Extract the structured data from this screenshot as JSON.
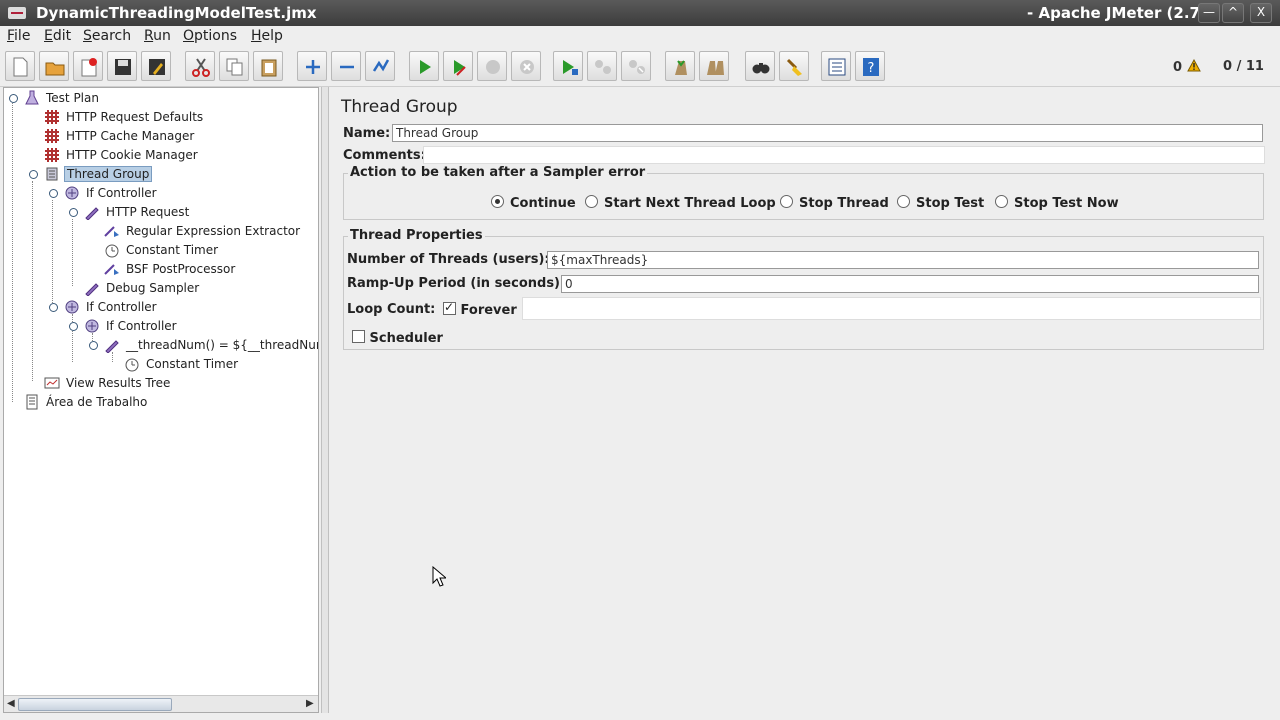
{
  "window": {
    "title_left": "DynamicThreadingModelTest.jmx",
    "title_right": "- Apache JMeter (2.7",
    "minimize_glyph": "—",
    "maximize_glyph": "^",
    "close_glyph": "X"
  },
  "menu": [
    {
      "mnemonic": "F",
      "rest": "ile"
    },
    {
      "mnemonic": "E",
      "rest": "dit"
    },
    {
      "mnemonic": "S",
      "rest": "earch"
    },
    {
      "mnemonic": "R",
      "rest": "un"
    },
    {
      "mnemonic": "O",
      "rest": "ptions"
    },
    {
      "mnemonic": "H",
      "rest": "elp"
    }
  ],
  "toolbar": {
    "error_count": "0",
    "thread_count": "0 / 11",
    "icons": [
      "new-icon",
      "open-icon",
      "close-icon",
      "save-icon",
      "save-as-icon",
      "cut-icon",
      "copy-icon",
      "paste-icon",
      "expand-icon",
      "collapse-icon",
      "toggle-icon",
      "start-icon",
      "start-no-timers-icon",
      "stop-icon",
      "shutdown-icon",
      "remote-start-icon",
      "remote-stop-icon",
      "remote-shutdown-icon",
      "clear-icon",
      "clear-all-icon",
      "search-icon",
      "reset-search-icon",
      "function-helper-icon",
      "help-icon"
    ]
  },
  "tree": {
    "items": [
      {
        "label": "Test Plan"
      },
      {
        "label": "HTTP Request Defaults"
      },
      {
        "label": "HTTP Cache Manager"
      },
      {
        "label": "HTTP Cookie Manager"
      },
      {
        "label": "Thread Group"
      },
      {
        "label": "If Controller"
      },
      {
        "label": "HTTP Request"
      },
      {
        "label": "Regular Expression Extractor"
      },
      {
        "label": "Constant Timer"
      },
      {
        "label": "BSF PostProcessor"
      },
      {
        "label": "Debug Sampler"
      },
      {
        "label": "If Controller"
      },
      {
        "label": "If Controller"
      },
      {
        "label": "__threadNum() = ${__threadNum("
      },
      {
        "label": "Constant Timer"
      },
      {
        "label": "View Results Tree"
      },
      {
        "label": "Área de Trabalho"
      }
    ]
  },
  "editor": {
    "title": "Thread Group",
    "name_label": "Name:",
    "name_value": "Thread Group",
    "comments_label": "Comments:",
    "comments_value": "",
    "sampler_error": {
      "legend": "Action to be taken after a Sampler error",
      "options": [
        "Continue",
        "Start Next Thread Loop",
        "Stop Thread",
        "Stop Test",
        "Stop Test Now"
      ],
      "selected": "Continue"
    },
    "thread_props": {
      "legend": "Thread Properties",
      "num_threads_label": "Number of Threads (users):",
      "num_threads_value": "${maxThreads}",
      "rampup_label": "Ramp-Up Period (in seconds):",
      "rampup_value": "0",
      "loop_label": "Loop Count:",
      "forever_label": "Forever",
      "forever_checked": true,
      "loop_value": "",
      "scheduler_label": "Scheduler",
      "scheduler_checked": false
    }
  }
}
